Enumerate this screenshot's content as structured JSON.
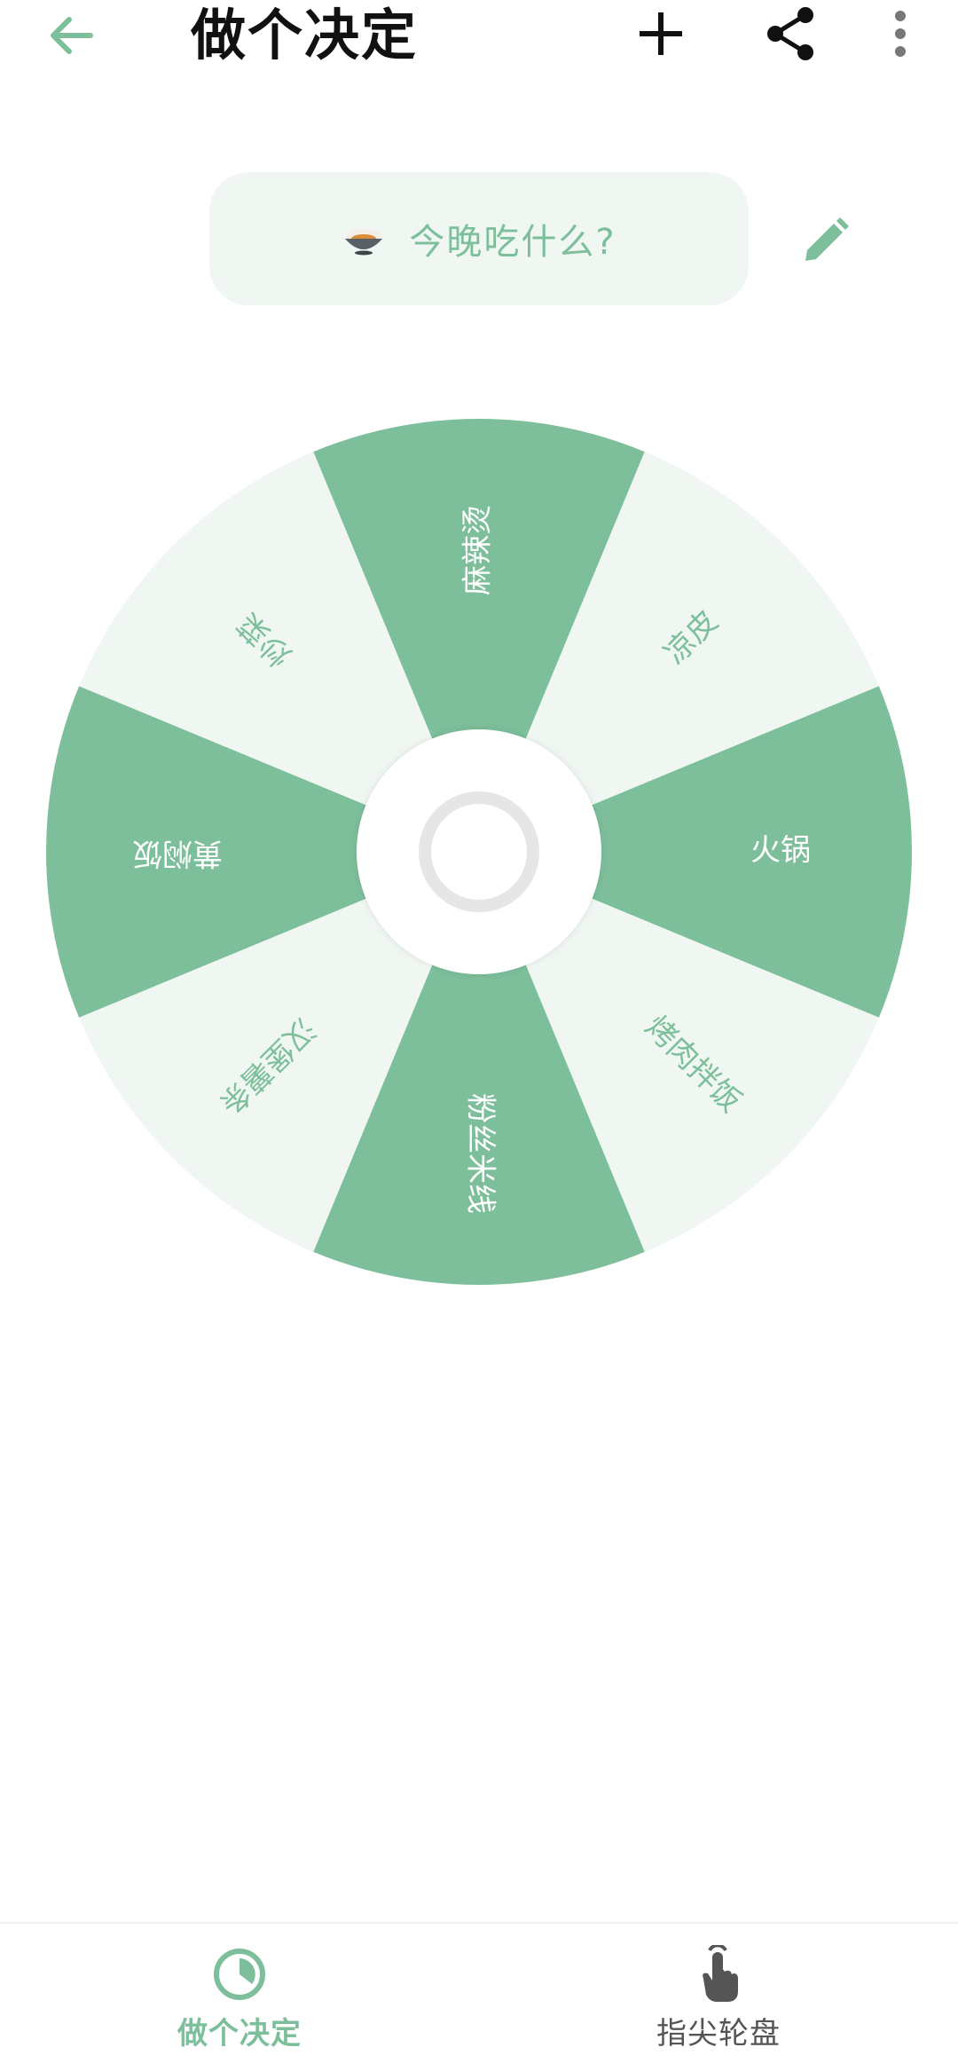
{
  "header": {
    "title": "做个决定",
    "back_icon": "arrow-left-icon",
    "add_icon": "plus-icon",
    "share_icon": "share-icon",
    "more_icon": "more-vertical-icon"
  },
  "question": {
    "icon": "rice-bowl-icon",
    "text": "今晚吃什么?",
    "edit_icon": "pencil-icon"
  },
  "wheel": {
    "segments": [
      "麻辣烫",
      "凉皮",
      "火锅",
      "烤肉拌饭",
      "粉丝米线",
      "汉堡薯条",
      "黄焖饭",
      "炒菜"
    ],
    "colors": {
      "dark": "#7dbf9b",
      "light": "#f0f7f2",
      "dark_text": "#ffffff",
      "light_text": "#7dbf9b"
    }
  },
  "bottom_nav": {
    "items": [
      {
        "label": "做个决定",
        "icon": "clock-pie-icon",
        "active": true
      },
      {
        "label": "指尖轮盘",
        "icon": "finger-touch-icon",
        "active": false
      }
    ]
  },
  "colors": {
    "accent": "#7dbf9b",
    "accent_light": "#f0f7f2"
  }
}
